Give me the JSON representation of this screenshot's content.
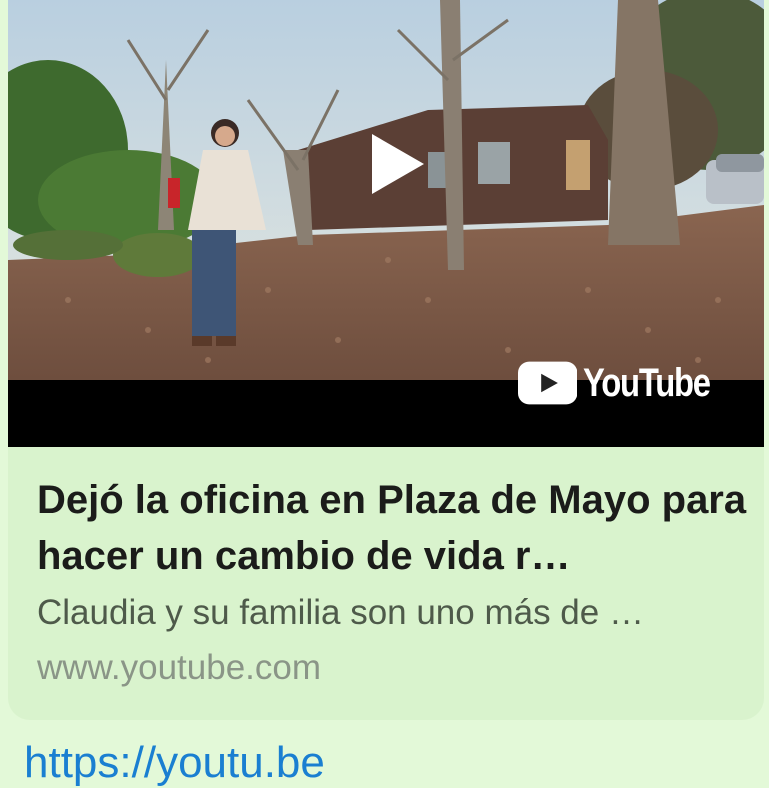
{
  "preview": {
    "title": "Dejó la oficina en Plaza de Mayo para hacer un cambio de vida r…",
    "description": "Claudia y su familia son uno más de …",
    "domain": "www.youtube.com",
    "thumbnail": {
      "play_icon": "play-icon",
      "logo_text": "YouTube",
      "logo_icon": "youtube-play-icon"
    }
  },
  "message": {
    "link_text": "https://youtu.be"
  },
  "colors": {
    "background": "#e3f9d8",
    "card": "#d9f3cd",
    "title": "#1b1c1a",
    "description": "#4e5a4a",
    "domain": "#8a9587",
    "link": "#1a7fd1"
  }
}
